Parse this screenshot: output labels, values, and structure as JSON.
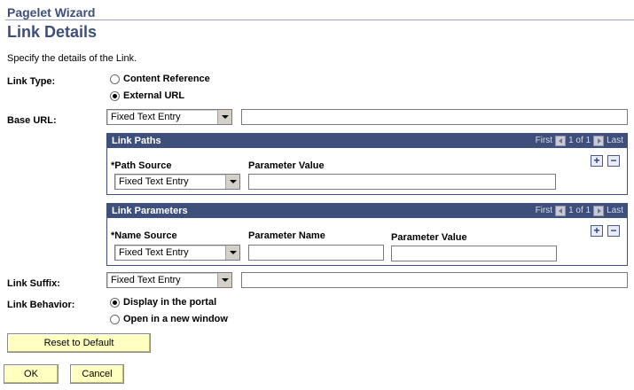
{
  "header": {
    "wizard_title": "Pagelet Wizard",
    "page_title": "Link Details"
  },
  "instructions": "Specify the details of the Link.",
  "link_type": {
    "label": "Link Type:",
    "options": [
      "Content Reference",
      "External URL"
    ],
    "selected": "External URL"
  },
  "base_url": {
    "label": "Base URL:",
    "source": "Fixed Text Entry",
    "value": ""
  },
  "link_paths": {
    "title": "Link Paths",
    "nav": {
      "first": "First",
      "range": "1 of 1",
      "last": "Last"
    },
    "columns": {
      "source": "*Path Source",
      "value": "Parameter Value"
    },
    "rows": [
      {
        "source": "Fixed Text Entry",
        "value": ""
      }
    ]
  },
  "link_parameters": {
    "title": "Link Parameters",
    "nav": {
      "first": "First",
      "range": "1 of 1",
      "last": "Last"
    },
    "columns": {
      "source": "*Name Source",
      "name": "Parameter Name",
      "value": "Parameter Value"
    },
    "rows": [
      {
        "source": "Fixed Text Entry",
        "name": "",
        "value": ""
      }
    ]
  },
  "link_suffix": {
    "label": "Link Suffix:",
    "source": "Fixed Text Entry",
    "value": ""
  },
  "link_behavior": {
    "label": "Link Behavior:",
    "options": [
      "Display in the portal",
      "Open in a new window"
    ],
    "selected": "Display in the portal"
  },
  "buttons": {
    "reset": "Reset to Default",
    "ok": "OK",
    "cancel": "Cancel"
  },
  "colors": {
    "accent": "#3d4f7a",
    "button_bg": "#ffffc0"
  }
}
